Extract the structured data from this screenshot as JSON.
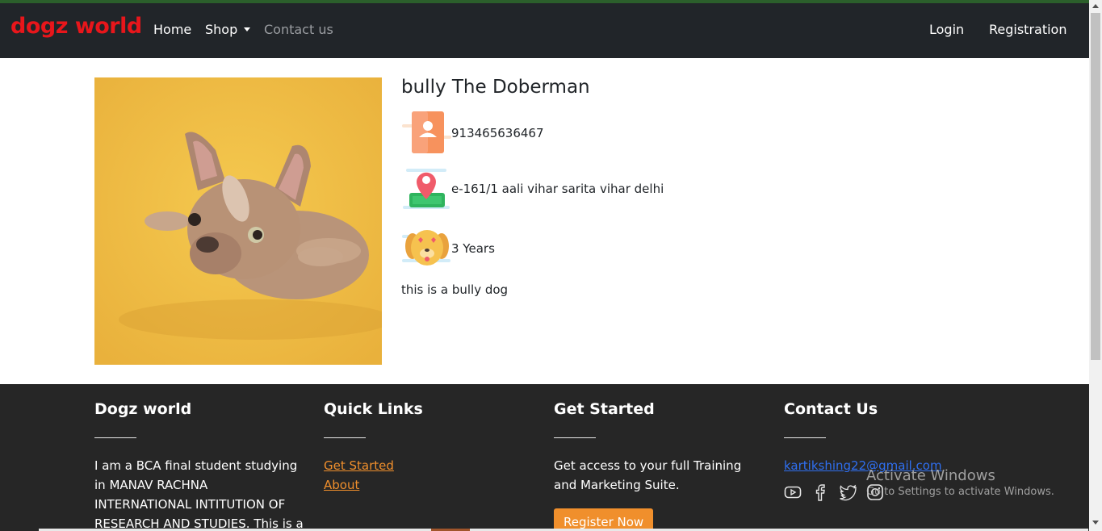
{
  "navbar": {
    "brand": "dogz world",
    "links": {
      "home": "Home",
      "shop": "Shop",
      "contact": "Contact us",
      "login": "Login",
      "registration": "Registration"
    }
  },
  "pet": {
    "title": "bully The Doberman",
    "phone": "913465636467",
    "address": "e-161/1 aali vihar sarita vihar delhi",
    "age": "3 Years",
    "description": "this is a bully dog"
  },
  "footer": {
    "about": {
      "title": "Dogz world",
      "text": "I am a BCA final student studying in MANAV RACHNA INTERNATIONAL INTITUTION OF RESEARCH AND STUDIES. This is a"
    },
    "quick_links": {
      "title": "Quick Links",
      "items": [
        "Get Started",
        "About"
      ]
    },
    "get_started": {
      "title": "Get Started",
      "text": "Get access to your full Training and Marketing Suite.",
      "button": "Register Now"
    },
    "contact": {
      "title": "Contact Us",
      "email": "kartikshing22@gmail.com",
      "social_icons": [
        "youtube-icon",
        "facebook-icon",
        "twitter-icon",
        "instagram-icon"
      ]
    }
  },
  "os_overlay": {
    "line1": "Activate Windows",
    "line2": "Go to Settings to activate Windows."
  },
  "colors": {
    "brand": "#e8161b",
    "navbar_bg": "#212529",
    "footer_bg": "#262626",
    "accent": "#f08f2c",
    "email_link": "#2f6ff0",
    "photo_bg": "#efc04a"
  }
}
